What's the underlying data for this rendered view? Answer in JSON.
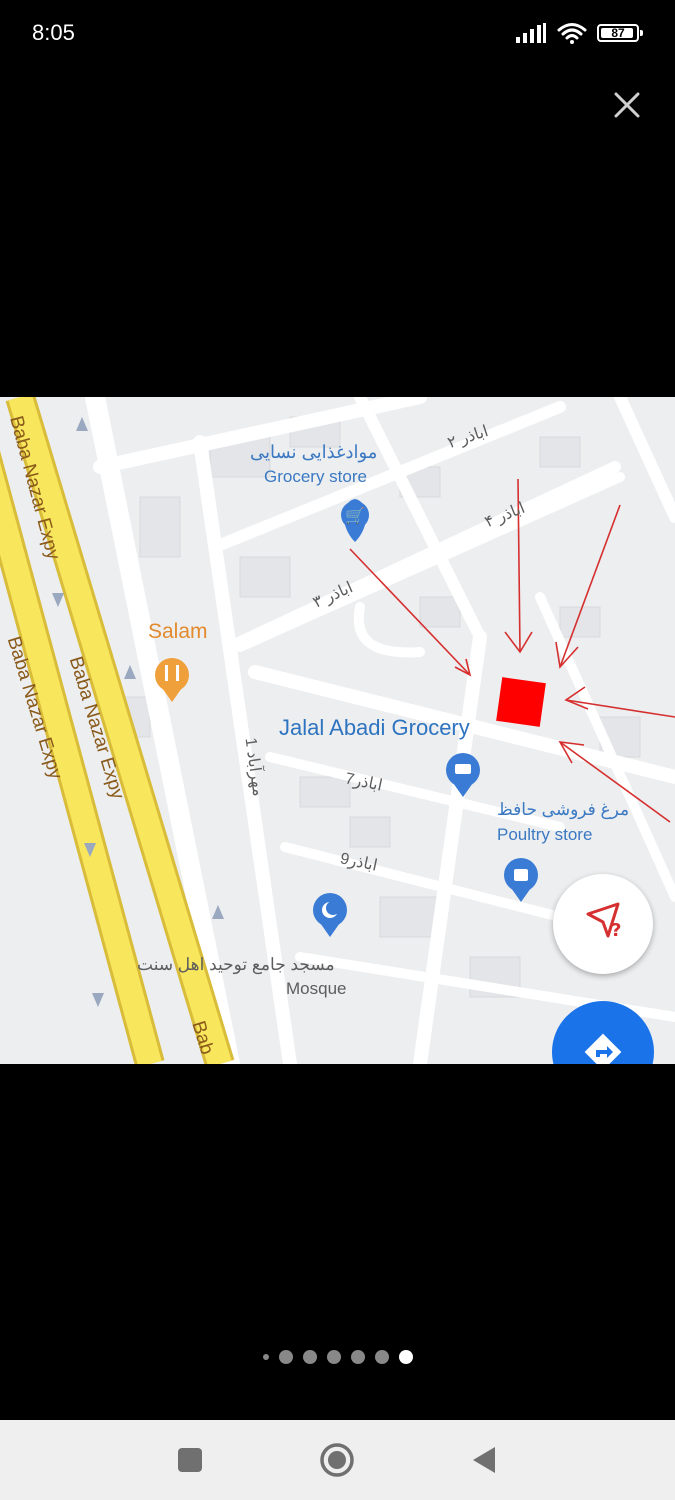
{
  "status_bar": {
    "time": "8:05",
    "battery_percent": "87",
    "icons": [
      "signal-icon",
      "wifi-icon",
      "battery-icon"
    ]
  },
  "viewer": {
    "close_icon": "close-icon",
    "pager": {
      "total": 7,
      "active_index": 6
    }
  },
  "map": {
    "places": {
      "grocery_top_fa": "موادغذایی نسایی",
      "grocery_top_en": "Grocery store",
      "salam": "Salam",
      "jalal_abadi": "Jalal Abadi Grocery",
      "poultry_fa": "مرغ فروشی حافظ",
      "poultry_en": "Poultry store",
      "mosque_fa": "مسجد جامع توحید اهل سنت",
      "mosque_en": "Mosque"
    },
    "streets": {
      "abazar2": "اباذر ۲",
      "abazar4": "اباذر ۴",
      "abazar3": "اباذر ۳",
      "abazar7": "اباذر7",
      "abazar9": "اباذر9",
      "mehrabad1": "مهرآباد 1"
    },
    "highway": {
      "label_1": "Baba Nazar Expy",
      "label_2": "Baba Nazar Expy",
      "label_3": "Baba Nazar Expy",
      "label_4": "Bab"
    },
    "colors": {
      "marker": "#ff0000",
      "arrows": "#d62f2f",
      "highway": "#f5e35a",
      "road": "#ffffff",
      "poi_blue": "#3a7bd5",
      "poi_orange": "#f0a03a"
    }
  },
  "nav_bar": {
    "buttons": [
      "recents-button",
      "home-button",
      "back-button"
    ]
  }
}
